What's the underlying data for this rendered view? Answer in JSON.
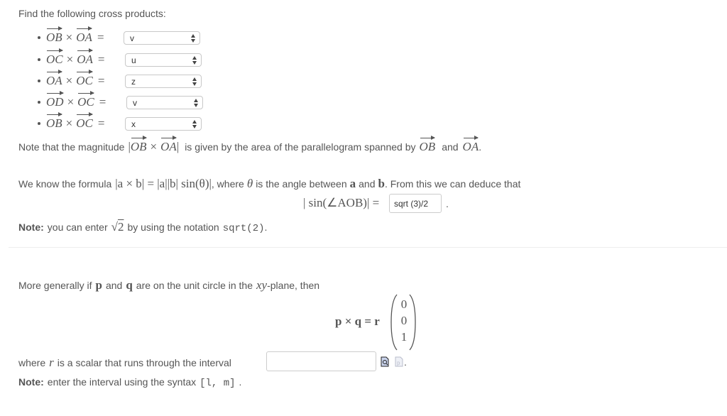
{
  "heading": "Find the following cross products:",
  "cross_products": [
    {
      "left": "OB",
      "right": "OA",
      "selected": "v"
    },
    {
      "left": "OC",
      "right": "OA",
      "selected": "u"
    },
    {
      "left": "OA",
      "right": "OC",
      "selected": "z"
    },
    {
      "left": "OD",
      "right": "OC",
      "selected": "v"
    },
    {
      "left": "OB",
      "right": "OC",
      "selected": "x"
    }
  ],
  "symbols": {
    "times": "×",
    "equals": "=",
    "dot": "."
  },
  "note_magnitude": {
    "prefix": "Note that the magnitude",
    "abs_left": "|",
    "vec1": "OB",
    "vec2": "OA",
    "abs_right": "|",
    "middle": "is given by the area of the parallelogram spanned by",
    "and": "and",
    "end": "."
  },
  "formula_line": {
    "prefix": "We know the formula",
    "formula": "|a × b| = |a||b| sin(θ)|",
    "middle": ", where",
    "theta": "θ",
    "rest1": "is the angle between",
    "a": "a",
    "and": "and",
    "b": "b",
    "rest2": ". From this we can deduce that"
  },
  "sin_equation": {
    "lhs": "| sin(∠AOB)| =",
    "answer": "sqrt (3)/2",
    "end": "."
  },
  "note_sqrt": {
    "label": "Note:",
    "text1": "you can enter",
    "sqrt_arg": "2",
    "text2": "by using the notation",
    "code": "sqrt(2)",
    "end": "."
  },
  "general": {
    "text1": "More generally if",
    "p": "p",
    "and": "and",
    "q": "q",
    "text2": "are on the unit circle in the",
    "xy": "xy",
    "text3": "-plane, then"
  },
  "cross_eq": {
    "lhs": "p × q = r",
    "vector": [
      "0",
      "0",
      "1"
    ]
  },
  "interval": {
    "text1": "where",
    "r": "r",
    "text2": "is a scalar that runs through the interval",
    "value": "",
    "end": "."
  },
  "note_interval": {
    "label": "Note:",
    "text": "enter the interval using the syntax",
    "code": "[l, m]",
    "end": "."
  },
  "icons": {
    "preview": "preview-icon",
    "pdf": "p-document-icon"
  }
}
